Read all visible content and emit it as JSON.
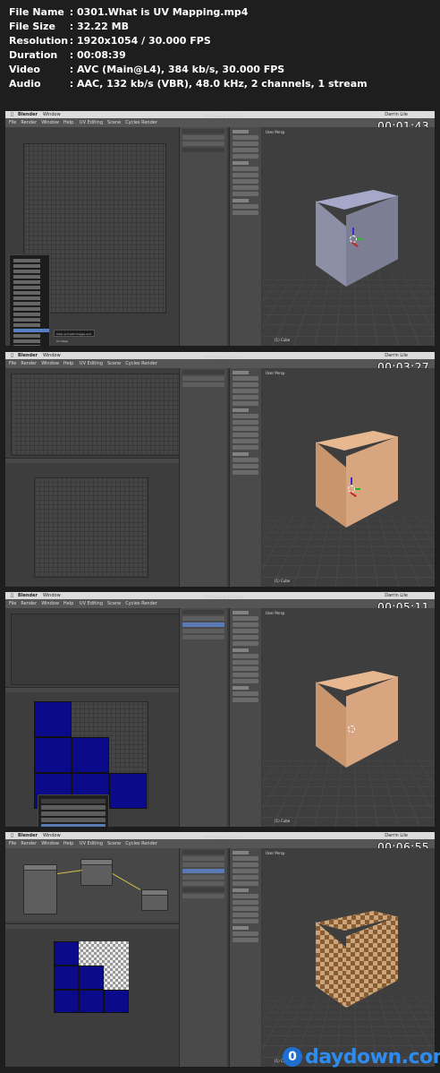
{
  "file_info": [
    {
      "label": "File Name",
      "value": "0301.What is UV Mapping.mp4"
    },
    {
      "label": "File Size",
      "value": "32.22 MB"
    },
    {
      "label": "Resolution",
      "value": "1920x1054 / 30.000 FPS"
    },
    {
      "label": "Duration",
      "value": "00:08:39"
    },
    {
      "label": "Video",
      "value": "AVC (Main@L4), 384 kb/s, 30.000 FPS"
    },
    {
      "label": "Audio",
      "value": "AAC, 132 kb/s (VBR), 48.0 kHz, 2 channels, 1 stream"
    }
  ],
  "separator": ":",
  "app": {
    "mac_menu_app": "Blender",
    "mac_menu_window": "Window",
    "mac_menu_user": "Darrin Lile",
    "window_title": "UV Mapping 01.blend",
    "header_menus": [
      "File",
      "Render",
      "Window",
      "Help"
    ],
    "layout_name": "UV Editing",
    "scene_name": "Scene",
    "render_engine": "Cycles Render",
    "viewport_label": "User Persp",
    "object_label": "(1) Cube"
  },
  "frames": [
    {
      "timestamp": "00:01:43",
      "editor_menu_tooltip": "View and edit images and UV Maps"
    },
    {
      "timestamp": "00:03:27"
    },
    {
      "timestamp": "00:05:11"
    },
    {
      "timestamp": "00:06:55"
    }
  ],
  "watermark": {
    "logo": "0",
    "text": "daydown.com"
  }
}
